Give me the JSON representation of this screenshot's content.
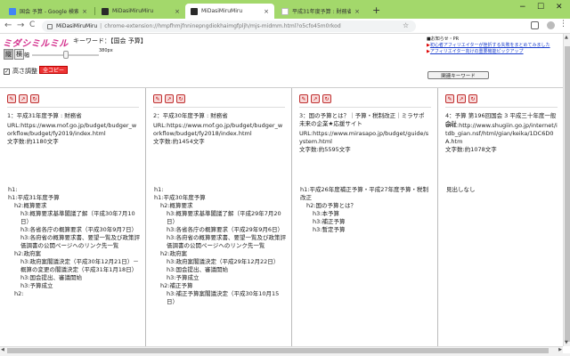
{
  "browser": {
    "tabs": [
      {
        "title": "国会 予算 - Google 検索",
        "favicon_color": "#4285f4",
        "active": false
      },
      {
        "title": "MiDasiMiruMiru",
        "favicon_color": "#2a2a2a",
        "active": false
      },
      {
        "title": "MiDasiMiruMiru",
        "favicon_color": "#2a2a2a",
        "active": true
      },
      {
        "title": "平成31年度予算 : 財務省",
        "favicon_color": "#bbbbbb",
        "active": false
      }
    ],
    "close_glyph": "×",
    "new_tab_glyph": "+",
    "window_controls": {
      "minimize": "−",
      "maximize": "☐",
      "close": "✕"
    },
    "nav": {
      "back": "←",
      "forward": "→",
      "reload": "C"
    },
    "address": {
      "site_name": "MiDasiMiruMiru",
      "separator": "|",
      "url": "chrome-extension://hmpfhmjfnninepngdiokhaimgfpljh/mjs-midmm.html?o5cfo45m0rkod",
      "bookmark_icon": "star-icon"
    }
  },
  "header": {
    "logo": "ミダシミルミル",
    "keyword_text": "キーワード：【国会 予算】",
    "view_vertical": "縦",
    "view_horizontal": "横",
    "width_label": "幅",
    "width_value": "380px",
    "width_slider_level": 0.5,
    "auto_height_label": "高さ調整",
    "auto_height_checked": true,
    "copy_button": "全コピー"
  },
  "notice": {
    "title": "■お知らせ・PR",
    "links": [
      "初心者アフィリエイターが挫折する失敗をまとめてみました",
      "アフィリエイター向けの重要機能ピックアップ"
    ],
    "related_button": "関連キーワード"
  },
  "columns": [
    {
      "title": "1：平成31年度予算 : 財務省",
      "url": "URL:https://www.mof.go.jp/budget/budger_workflow/budget/fy2019/index.html",
      "size": "文字数:約1180文字",
      "outline": [
        {
          "lvl": 0,
          "text": "h1:"
        },
        {
          "lvl": 0,
          "text": "h1:平成31年度予算"
        },
        {
          "lvl": 1,
          "text": "h2:概算要求"
        },
        {
          "lvl": 2,
          "text": "h3:概算要求基準閣議了解（平成30年7月10日）"
        },
        {
          "lvl": 2,
          "text": "h3:各省各庁の概算要求（平成30年9月7日）"
        },
        {
          "lvl": 2,
          "text": "h3:各府省の概算要求書、要望一覧及び政策評価調書の公開ページへのリンク先一覧"
        },
        {
          "lvl": 1,
          "text": "h2:政府案"
        },
        {
          "lvl": 2,
          "text": "h3:政府案閣議決定（平成30年12月21日）－ 概算の変更の閣議決定（平成31年1月18日）"
        },
        {
          "lvl": 2,
          "text": "h3:国会提出、審議開始"
        },
        {
          "lvl": 2,
          "text": "h3:予算成立"
        },
        {
          "lvl": 1,
          "text": "h2:"
        }
      ]
    },
    {
      "title": "2：平成30年度予算 : 財務省",
      "url": "URL:https://www.mof.go.jp/budget/budger_workflow/budget/fy2018/index.html",
      "size": "文字数:約1454文字",
      "outline": [
        {
          "lvl": 0,
          "text": "h1:"
        },
        {
          "lvl": 0,
          "text": "h1:平成30年度予算"
        },
        {
          "lvl": 1,
          "text": "h2:概算要求"
        },
        {
          "lvl": 2,
          "text": "h3:概算要求基準閣議了解（平成29年7月20日）"
        },
        {
          "lvl": 2,
          "text": "h3:各省各庁の概算要求（平成29年9月6日）"
        },
        {
          "lvl": 2,
          "text": "h3:各府省の概算要求書、要望一覧及び政策評価調書の公開ページへのリンク先一覧"
        },
        {
          "lvl": 1,
          "text": "h2:政府案"
        },
        {
          "lvl": 2,
          "text": "h3:政府案閣議決定（平成29年12月22日）"
        },
        {
          "lvl": 2,
          "text": "h3:国会提出、審議開始"
        },
        {
          "lvl": 2,
          "text": "h3:予算成立"
        },
        {
          "lvl": 1,
          "text": "h2:補正予算"
        },
        {
          "lvl": 2,
          "text": "h3:補正予算案閣議決定（平成30年10月15日）"
        }
      ]
    },
    {
      "title": "3：国の予算とは？｜予算・税制改正｜ミラサポ 未来の企業★応援サイト",
      "url": "URL:https://www.mirasapo.jp/budget/guide/system.html",
      "size": "文字数:約5595文字",
      "outline": [
        {
          "lvl": 0,
          "text": "h1:平成26年度補正予算・平成27年度予算・税制改正"
        },
        {
          "lvl": 1,
          "text": "h2:国の予算とは？"
        },
        {
          "lvl": 2,
          "text": "h3:本予算"
        },
        {
          "lvl": 2,
          "text": "h3:補正予算"
        },
        {
          "lvl": 2,
          "text": "h3:暫定予算"
        }
      ]
    },
    {
      "title": "4：予算 第196回国会 3 平成三十年度一般会計",
      "url": "URL:http://www.shugiin.go.jp/internet/itdb_gian.nsf/html/gian/keika/1DC6D0A.htm",
      "size": "文字数:約1078文字",
      "outline": [
        {
          "lvl": 0,
          "text": "見出しなし"
        }
      ]
    }
  ],
  "column_icons": [
    "edit-icon",
    "open-icon",
    "refresh-icon"
  ],
  "column_icon_glyphs": [
    "✎",
    "↗",
    "↻"
  ],
  "colors": {
    "tabstrip": "#a3d86b",
    "logo": "#d22a8a",
    "copy_button": "#ee3333",
    "link": "#1a3dcc"
  }
}
